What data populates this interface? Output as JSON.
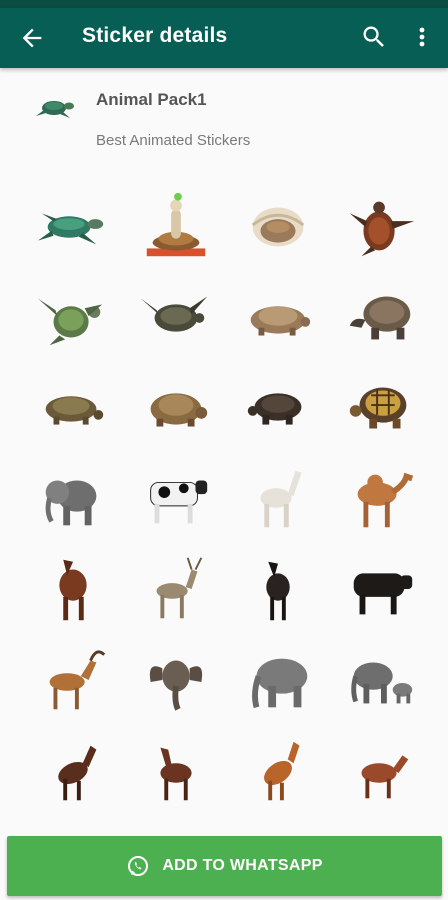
{
  "app_bar": {
    "title": "Sticker details",
    "icons": [
      "back-arrow-icon",
      "search-icon",
      "more-vert-icon"
    ]
  },
  "pack": {
    "name": "Animal Pack1",
    "subtitle": "Best Animated Stickers",
    "icon": "turtle-tray-icon"
  },
  "stickers": [
    "sea-turtle",
    "turtle-figurine",
    "tortoise-hatchling",
    "swimming-turtle",
    "sea-turtle-swimming",
    "turtle-top-view",
    "tortoise",
    "giant-tortoise",
    "tortoise-small",
    "tortoise-walking",
    "dark-tortoise",
    "star-tortoise",
    "elephant-calf",
    "cow",
    "white-horse",
    "camel",
    "brown-horse",
    "deer",
    "black-horse",
    "bull",
    "goat",
    "elephant-front",
    "grey-elephant",
    "elephant-with-calf",
    "rearing-horse",
    "galloping-horse",
    "chestnut-horse-rearing",
    "brown-horse-running"
  ],
  "footer": {
    "add_button_label": "ADD TO WHATSAPP",
    "icon": "whatsapp-icon",
    "color": "#4caf50"
  }
}
